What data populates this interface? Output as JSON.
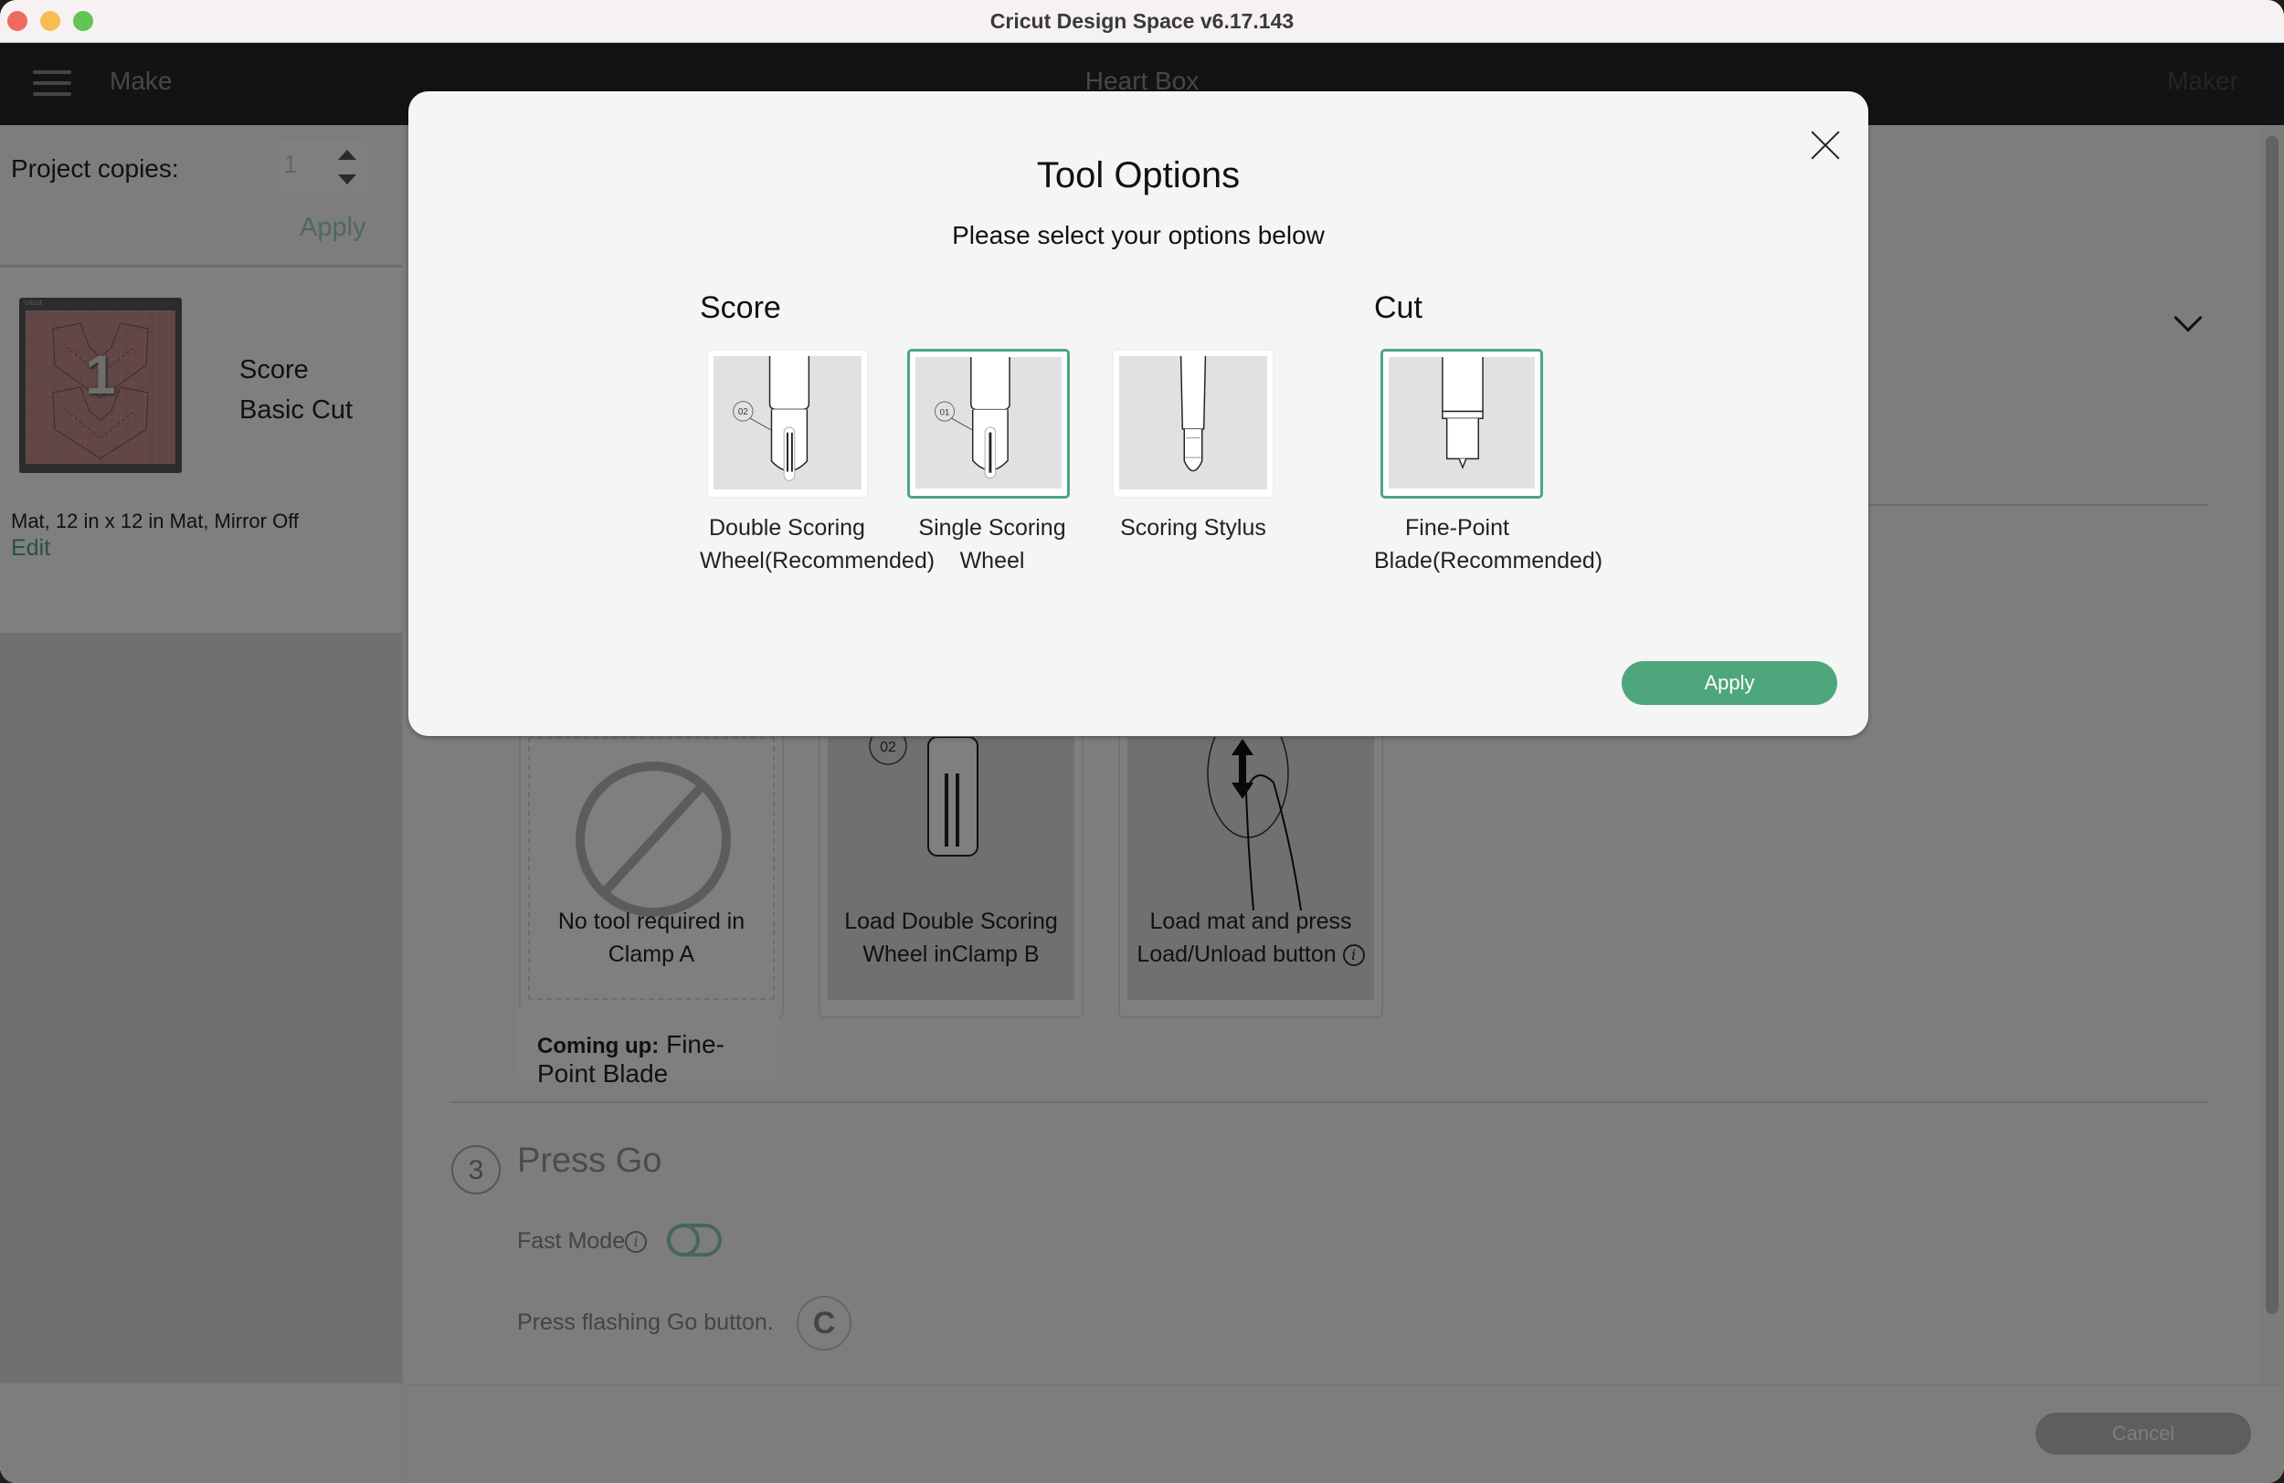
{
  "window": {
    "title": "Cricut Design Space  v6.17.143"
  },
  "appbar": {
    "menu_icon": "hamburger-icon",
    "mode": "Make",
    "project_name": "Heart Box",
    "machine": "Maker"
  },
  "left_panel": {
    "copies_label": "Project copies:",
    "copies_value": "1",
    "copies_apply": "Apply",
    "mat": {
      "number": "1",
      "brand": "cricut",
      "tools": [
        "Score",
        "Basic Cut"
      ],
      "description": "Mat, 12 in x 12 in Mat, Mirror Off",
      "edit_label": "Edit"
    }
  },
  "main": {
    "steps": [
      {
        "caption_1": "No tool required in",
        "caption_2": "Clamp A"
      },
      {
        "caption_1": "Load Double Scoring",
        "caption_2": "Wheel inClamp B",
        "badge": "02"
      },
      {
        "caption_1": "Load mat and press",
        "caption_2": "Load/Unload button"
      }
    ],
    "coming_up_label": "Coming up:",
    "coming_up_value": "Fine-Point Blade",
    "press_go": {
      "number": "3",
      "title": "Press Go",
      "fast_mode_label": "Fast Mode",
      "fast_mode_on": false,
      "instruction": "Press flashing Go button."
    },
    "cancel_label": "Cancel"
  },
  "modal": {
    "title": "Tool Options",
    "subtitle": "Please select your options below",
    "apply_label": "Apply",
    "accent_color": "#4ea67d",
    "groups": [
      {
        "label": "Score",
        "options": [
          {
            "line_1": "Double Scoring",
            "line_2": "Wheel(Recommended)",
            "badge": "02",
            "selected": false
          },
          {
            "line_1": "Single Scoring",
            "line_2": "Wheel",
            "badge": "01",
            "selected": true
          },
          {
            "line_1": "Scoring Stylus",
            "line_2": "",
            "selected": false
          }
        ]
      },
      {
        "label": "Cut",
        "options": [
          {
            "line_1": "Fine-Point",
            "line_2": "Blade(Recommended)",
            "selected": true
          }
        ]
      }
    ]
  }
}
